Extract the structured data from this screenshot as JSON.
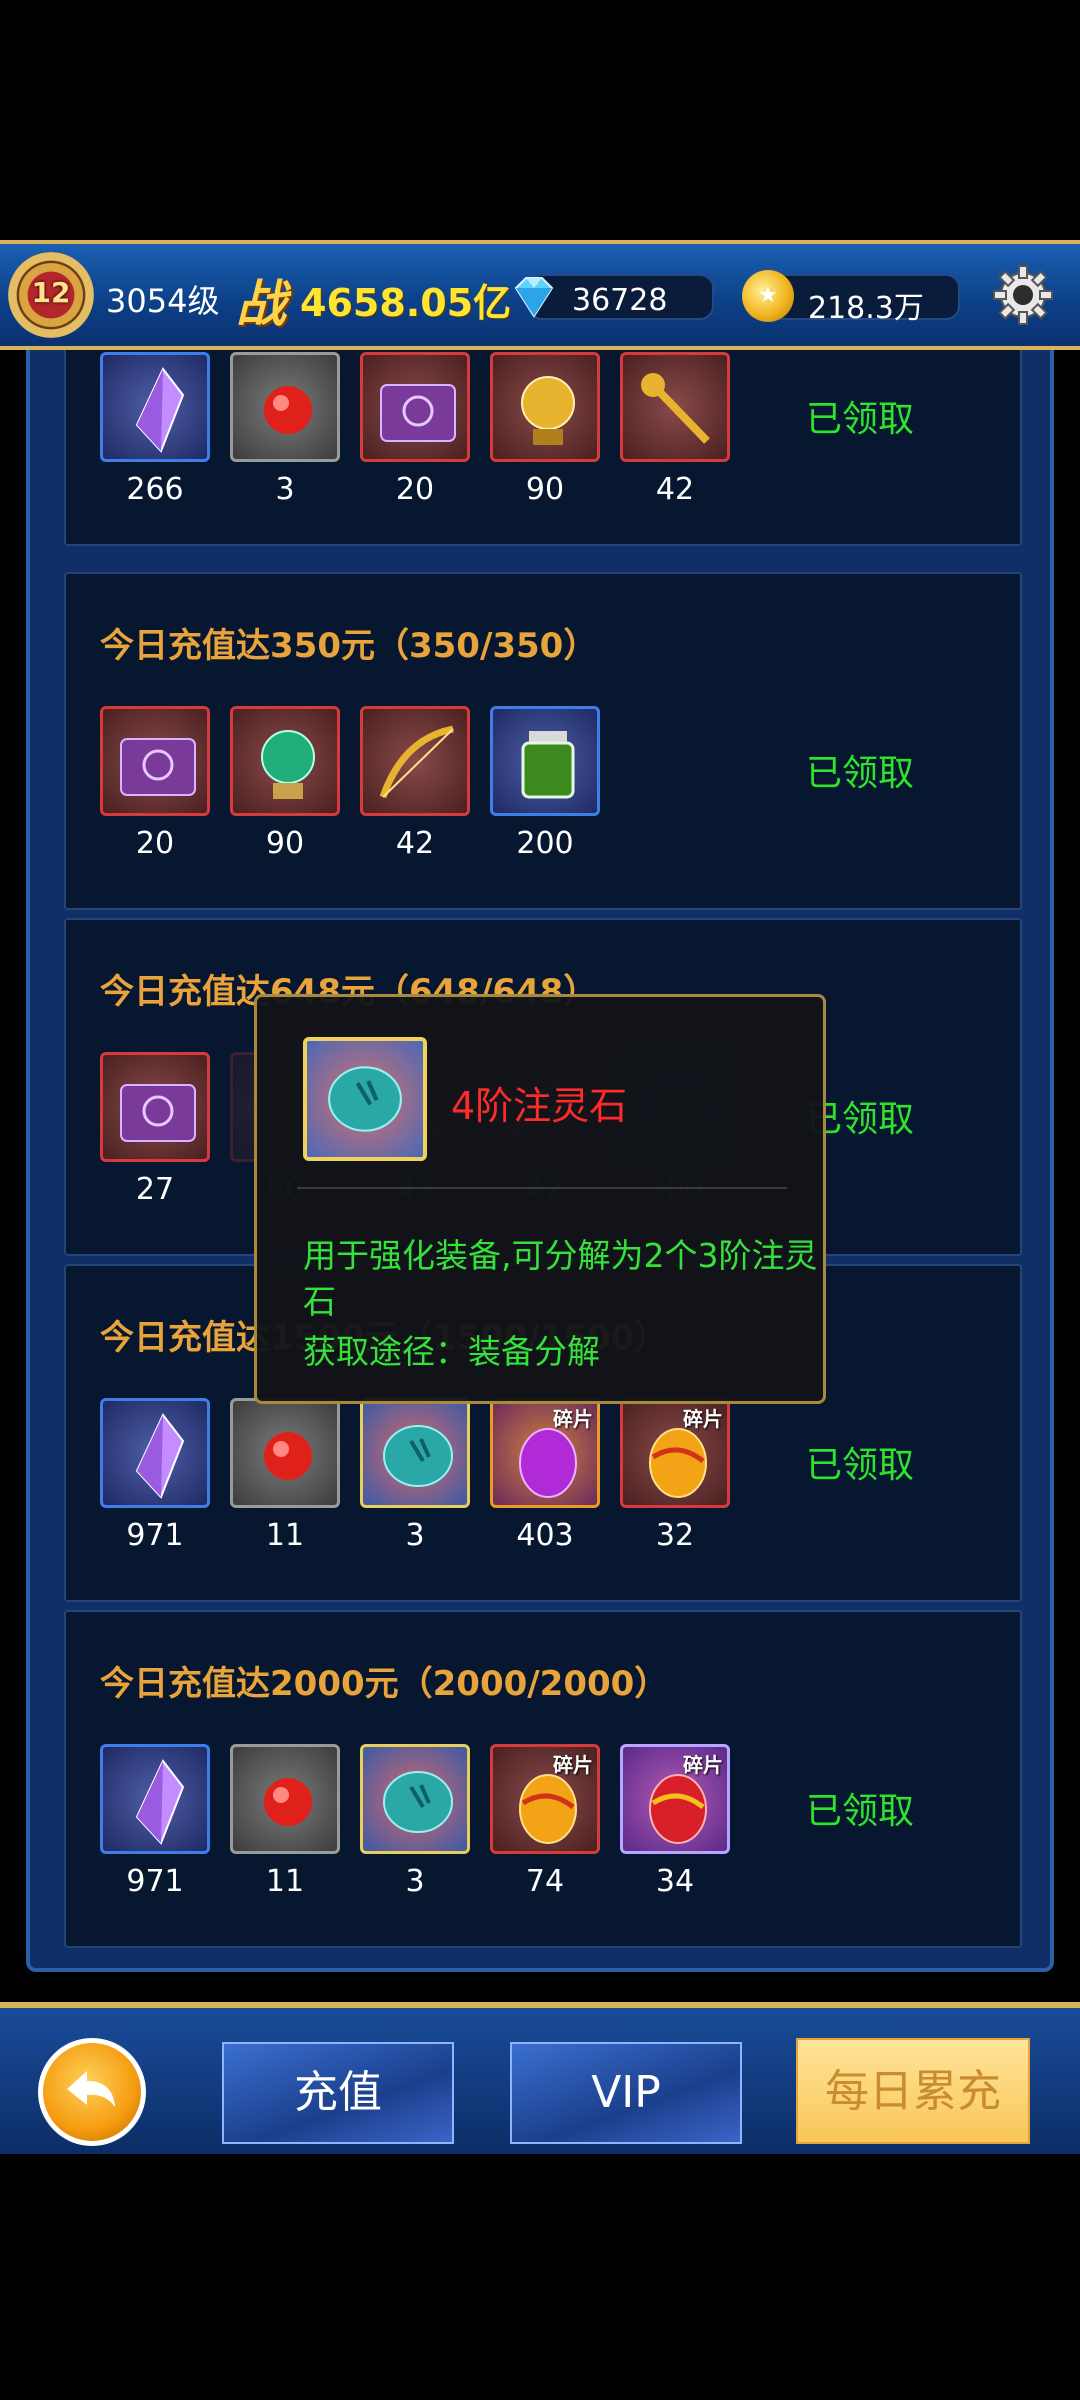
{
  "header": {
    "level_badge": "12",
    "level_text": "3054级",
    "power_label": "战",
    "power_value": "4658.05亿",
    "diamonds": "36728",
    "gold": "218.3万"
  },
  "cards": [
    {
      "title": "",
      "status": "已领取",
      "items": [
        {
          "icon": "purple-crystal-icon",
          "count": "266"
        },
        {
          "icon": "red-gem-icon",
          "count": "3"
        },
        {
          "icon": "purple-book-icon",
          "count": "20"
        },
        {
          "icon": "golden-orb-icon",
          "count": "90"
        },
        {
          "icon": "golden-key-icon",
          "count": "42"
        }
      ]
    },
    {
      "title": "今日充值达350元（350/350）",
      "status": "已领取",
      "items": [
        {
          "icon": "purple-book-icon",
          "count": "20"
        },
        {
          "icon": "green-orb-icon",
          "count": "90"
        },
        {
          "icon": "golden-bow-icon",
          "count": "42"
        },
        {
          "icon": "green-potion-icon",
          "count": "200"
        }
      ]
    },
    {
      "title": "今日充值达648元（648/648）",
      "status": "已领取",
      "items": [
        {
          "icon": "purple-book-icon",
          "count": "27"
        },
        {
          "icon": "red-orb-icon",
          "count": "90"
        },
        {
          "icon": "golden-key-icon",
          "count": "42"
        },
        {
          "icon": "golden-bow-icon",
          "count": "42"
        },
        {
          "icon": "green-potion-icon",
          "count": "200"
        }
      ]
    },
    {
      "title": "今日充值达1500元（1500/1500）",
      "status": "已领取",
      "items": [
        {
          "icon": "purple-crystal-icon",
          "count": "971"
        },
        {
          "icon": "red-gem-icon",
          "count": "11"
        },
        {
          "icon": "spirit-stone-icon",
          "count": "3"
        },
        {
          "icon": "purple-egg-fragment-icon",
          "count": "403",
          "fragment": "碎片"
        },
        {
          "icon": "gold-egg-fragment-icon",
          "count": "32",
          "fragment": "碎片"
        }
      ]
    },
    {
      "title": "今日充值达2000元（2000/2000）",
      "status": "已领取",
      "items": [
        {
          "icon": "purple-crystal-icon",
          "count": "971"
        },
        {
          "icon": "red-gem-icon",
          "count": "11"
        },
        {
          "icon": "spirit-stone-icon",
          "count": "3"
        },
        {
          "icon": "gold-egg-fragment-icon",
          "count": "74",
          "fragment": "碎片"
        },
        {
          "icon": "red-egg-fragment-icon",
          "count": "34",
          "fragment": "碎片"
        }
      ]
    }
  ],
  "tooltip": {
    "name": "4阶注灵石",
    "description": "用于强化装备,可分解为2个3阶注灵石",
    "source": "获取途径：装备分解"
  },
  "bottom": {
    "recharge": "充值",
    "vip": "VIP",
    "daily": "每日累充"
  },
  "colors": {
    "title_gold": "#e8a43a",
    "claimed_green": "#2ee22e",
    "tooltip_name_red": "#ff2a2a",
    "tooltip_text_green": "#34e23a"
  }
}
